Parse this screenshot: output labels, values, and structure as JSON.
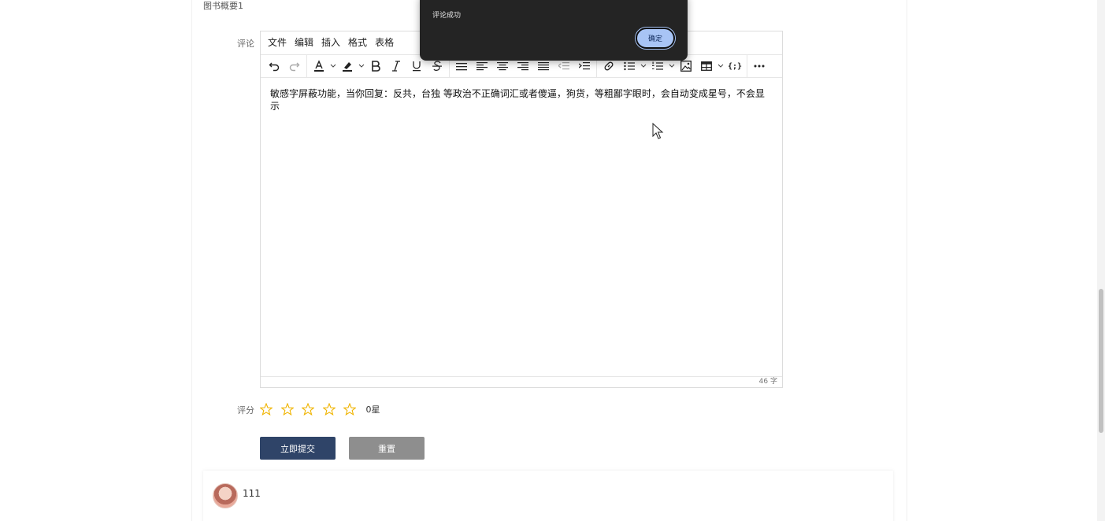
{
  "book_summary": "图书概要1",
  "comment_form": {
    "comment_label": "评论",
    "menu": [
      "文件",
      "编辑",
      "插入",
      "格式",
      "表格"
    ],
    "toolbar_icons": [
      "undo-icon",
      "redo-icon",
      "text-color-icon",
      "highlight-color-icon",
      "bold-icon",
      "italic-icon",
      "underline-icon",
      "strikethrough-icon",
      "line-height-icon",
      "align-left-icon",
      "align-center-icon",
      "align-right-icon",
      "align-justify-icon",
      "outdent-icon",
      "indent-icon",
      "link-icon",
      "bullet-list-icon",
      "numbered-list-icon",
      "image-icon",
      "table-icon",
      "code-icon",
      "more-icon"
    ],
    "editor_text": "敏感字屏蔽功能，当你回复：反共，台独 等政治不正确词汇或者傻逼，狗货，等粗鄙字眼时，会自动变成星号，不会显示",
    "word_count": "46 字",
    "rating_label": "评分",
    "rating_value": 0,
    "rating_max": 5,
    "rating_text": "0星",
    "submit_label": "立即提交",
    "reset_label": "重置"
  },
  "comment_list": {
    "items": [
      {
        "username": "111"
      }
    ]
  },
  "dialog": {
    "message": "评论成功",
    "ok_label": "确定"
  },
  "colors": {
    "submit_button": "#2f4468",
    "reset_button": "#8e8e8e",
    "dialog_bg": "#242424",
    "dialog_ok": "#a8c4f5",
    "star": "#f0b400"
  }
}
